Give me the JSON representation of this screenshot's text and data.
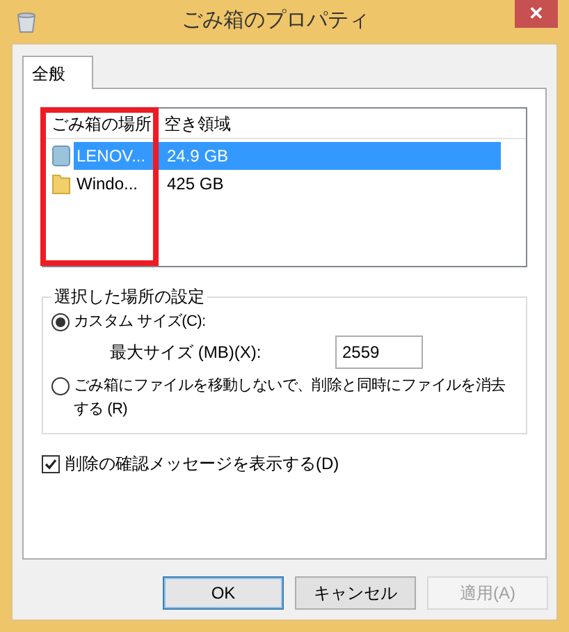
{
  "window": {
    "title": "ごみ箱のプロパティ",
    "close": "✕"
  },
  "tabs": [
    {
      "label": "全般",
      "selected": true
    }
  ],
  "locations": {
    "columns": [
      "ごみ箱の場所",
      "空き領域"
    ],
    "rows": [
      {
        "name": "LENOV...",
        "free": "24.9 GB",
        "selected": true,
        "kind": "drive"
      },
      {
        "name": "Windo...",
        "free": "425 GB",
        "selected": false,
        "kind": "folder"
      }
    ]
  },
  "settings": {
    "title": "選択した場所の設定",
    "options": [
      {
        "label": "カスタム サイズ(C):",
        "selected": true
      },
      {
        "label": "ごみ箱にファイルを移動しないで、削除と同時にファイルを消去する (R)",
        "selected": false
      }
    ],
    "max_size": {
      "label": "最大サイズ (MB)(X):",
      "value": "2559"
    }
  },
  "confirm": {
    "label": "削除の確認メッセージを表示する(D)",
    "checked": true
  },
  "buttons": [
    {
      "label": "OK",
      "default": true,
      "disabled": false
    },
    {
      "label": "キャンセル",
      "default": false,
      "disabled": false
    },
    {
      "label": "適用(A)",
      "default": false,
      "disabled": true
    }
  ]
}
